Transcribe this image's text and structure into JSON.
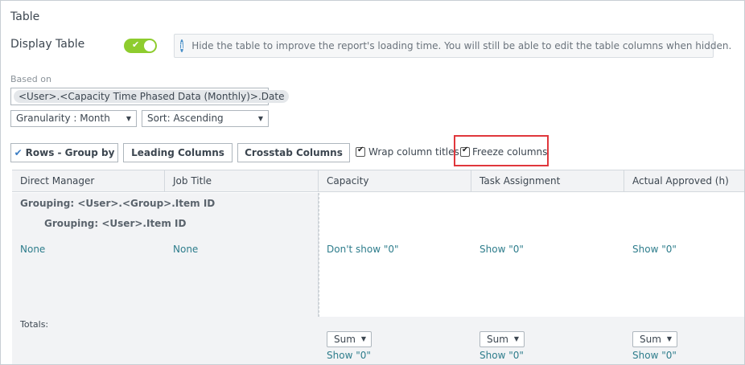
{
  "section": {
    "title": "Table"
  },
  "display_table": {
    "label": "Display Table",
    "toggle_check": "✔",
    "info_icon": "i",
    "info_text": "Hide the table to improve the report's loading time. You will still be able to edit the table columns when hidden."
  },
  "based_on": {
    "label": "Based on",
    "value": "<User>.<Capacity Time Phased Data (Monthly)>.Date"
  },
  "selects": {
    "granularity": "Granularity : Month",
    "sort": "Sort: Ascending",
    "caret": "▼"
  },
  "toolbar": {
    "rows_check": "✔",
    "rows_label": "Rows - Group by",
    "leading_label": "Leading Columns",
    "crosstab_label": "Crosstab Columns",
    "wrap_label": "Wrap column titles",
    "freeze_label": "Freeze columns"
  },
  "table": {
    "columns": [
      "Direct Manager",
      "Job Title",
      "Capacity",
      "Task Assignment",
      "Actual Approved (h)"
    ],
    "grouping_1": "Grouping: <User>.<Group>.Item ID",
    "grouping_2": "Grouping: <User>.Item ID",
    "cells": [
      "None",
      "None",
      "Don't show \"0\"",
      "Show \"0\"",
      "Show \"0\""
    ],
    "totals_label": "Totals:",
    "sum_label": "Sum",
    "sum_caret": "▼",
    "totals_show": [
      "Show \"0\"",
      "Show \"0\"",
      "Show \"0\""
    ]
  },
  "colors": {
    "toggle_on": "#8ecc2e",
    "link": "#2e7d8c",
    "highlight": "#e0373c",
    "info_icon": "#4a90c8"
  }
}
